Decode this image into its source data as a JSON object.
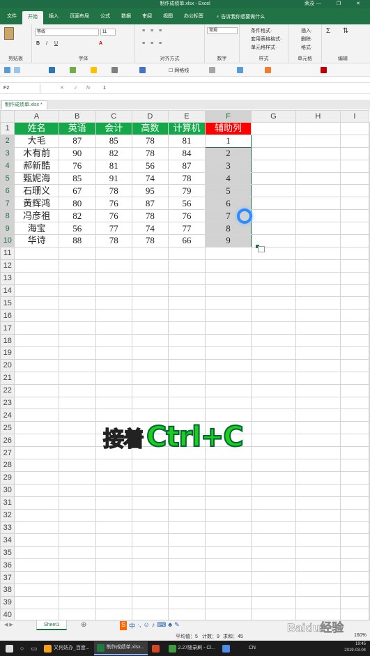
{
  "window": {
    "title": "制作成绩单.xlsx  -  Excel",
    "user": "荣茂",
    "controls": "— ❐ ✕"
  },
  "ribbon_tabs": [
    "文件",
    "开始",
    "插入",
    "页面布局",
    "公式",
    "数据",
    "审阅",
    "视图",
    "办公标签"
  ],
  "tell_me": "♀ 告诉我你想要做什么",
  "ribbon": {
    "groups": [
      "剪贴板",
      "字体",
      "对齐方式",
      "数字",
      "样式",
      "单元格",
      "编辑"
    ],
    "font_name": "等线",
    "font_size": "11",
    "number_format": "常规",
    "style_items": [
      "条件格式·",
      "套用表格格式·",
      "单元格样式·"
    ],
    "cell_items": [
      "插入·",
      "删除·",
      "格式·"
    ],
    "qa_gridline": "网格线"
  },
  "formula_bar": {
    "name_box": "F2",
    "value": "1",
    "fx": "fx"
  },
  "doc_tab": "制作成绩单.xlsx *",
  "columns": [
    "A",
    "B",
    "C",
    "D",
    "E",
    "F",
    "G",
    "H",
    "I"
  ],
  "headers": [
    "姓名",
    "英语",
    "会计",
    "高数",
    "计算机",
    "辅助列"
  ],
  "rows": [
    [
      "大毛",
      "87",
      "85",
      "78",
      "81",
      "1"
    ],
    [
      "木有前",
      "90",
      "82",
      "78",
      "84",
      "2"
    ],
    [
      "郝新酷",
      "76",
      "81",
      "56",
      "87",
      "3"
    ],
    [
      "甄妮海",
      "85",
      "91",
      "74",
      "78",
      "4"
    ],
    [
      "石珊义",
      "67",
      "78",
      "95",
      "79",
      "5"
    ],
    [
      "黄辉鸿",
      "80",
      "76",
      "87",
      "56",
      "6"
    ],
    [
      "冯彦祖",
      "82",
      "76",
      "78",
      "76",
      "7"
    ],
    [
      "海宝",
      "56",
      "77",
      "74",
      "77",
      "8"
    ],
    [
      "华诗",
      "88",
      "78",
      "78",
      "66",
      "9"
    ]
  ],
  "row_count": 40,
  "caption": {
    "part1": "接着",
    "part2": "Ctrl+C"
  },
  "sheet": {
    "tab": "Sheet1",
    "add": "⊕"
  },
  "status": {
    "average": "平均值：5",
    "count": "计数：9",
    "sum": "求和：45",
    "zoom": "160%"
  },
  "taskbar": [
    {
      "label": "又何妨办_百度...",
      "color": "#f4a11c"
    },
    {
      "label": "制作成绩单.xlsx...",
      "color": "#1f7a44"
    },
    {
      "label": "",
      "color": "#d24726"
    },
    {
      "label": "2.27随录刷 - Cl...",
      "color": "#3f9b3f"
    },
    {
      "label": "",
      "color": "#4d8ce8"
    },
    {
      "label": "CN",
      "color": "#1b1b1b"
    }
  ],
  "clock": {
    "time": "19:45",
    "date": "2019-03-04"
  },
  "watermark": {
    "brand": "Baidu经验",
    "url": "jingyan.baidu.com"
  }
}
